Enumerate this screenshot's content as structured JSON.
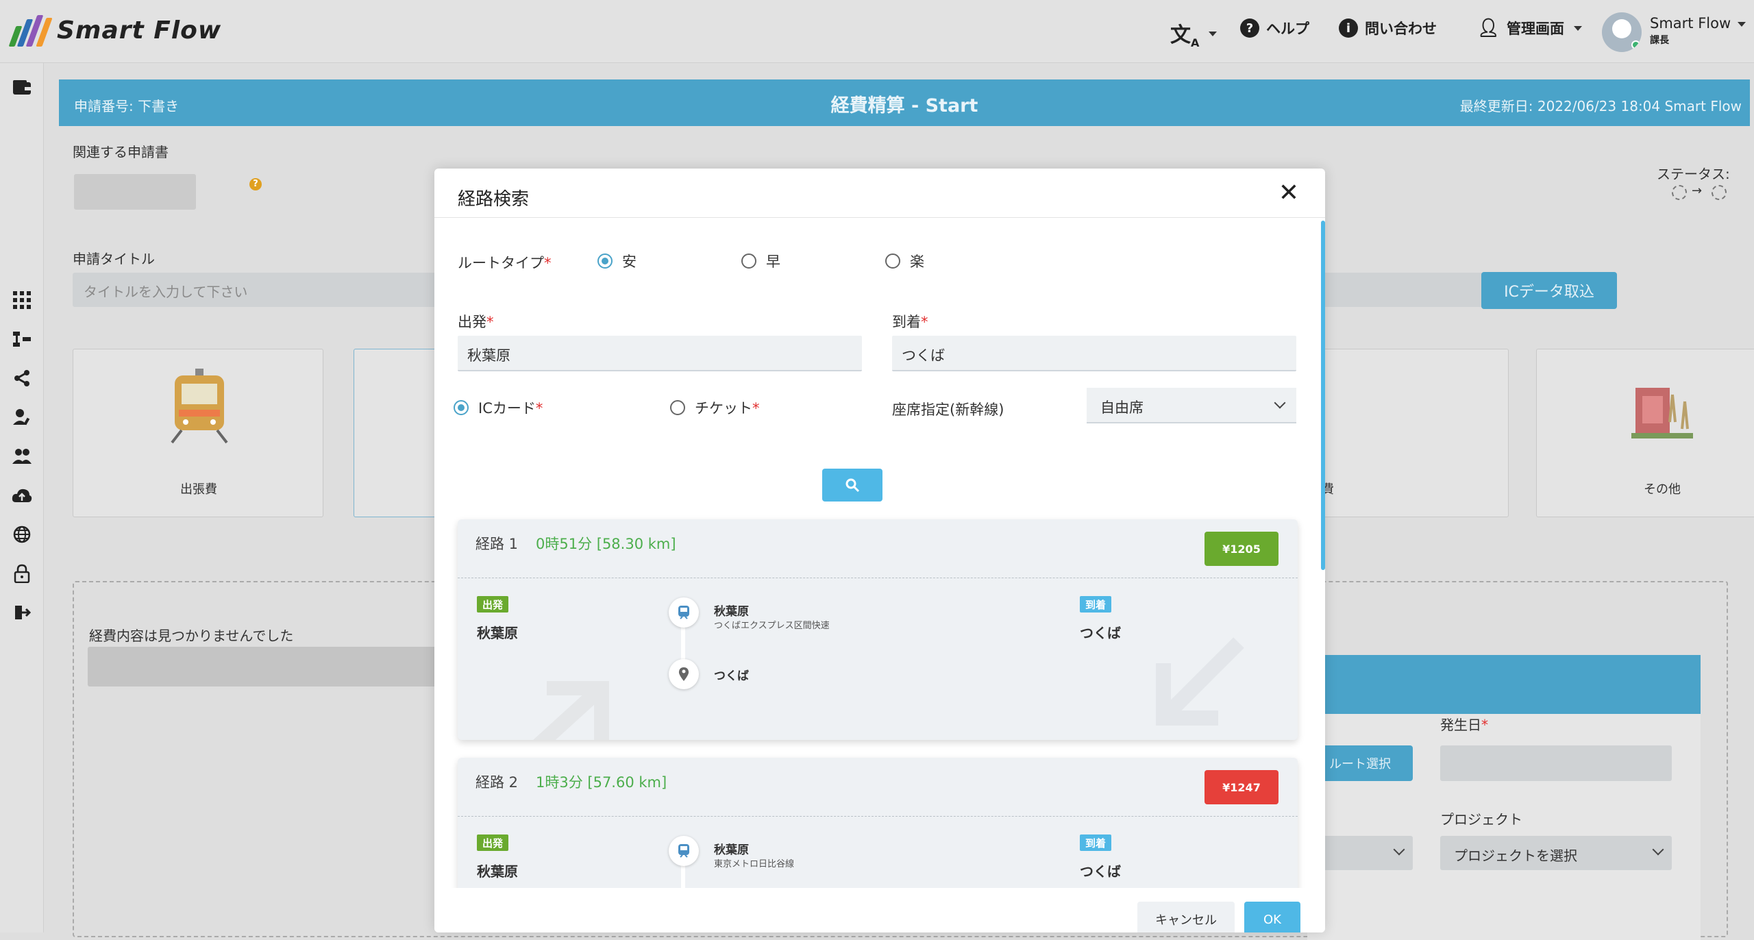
{
  "app": {
    "name": "Smart Flow"
  },
  "topnav": {
    "translate_icon": "translate-icon",
    "help_label": "ヘルプ",
    "contact_label": "問い合わせ",
    "admin_label": "管理画面",
    "user_name": "Smart Flow",
    "user_role": "課長"
  },
  "page": {
    "request_no": "申請番号: 下書き",
    "title": "経費精算 - Start",
    "last_updated": "最終更新日: 2022/06/23 18:04 Smart Flow",
    "related_label": "関連する申請書",
    "status_label": "ステータス:",
    "request_title_label": "申請タイトル",
    "request_title_placeholder": "タイトルを入力して下さい",
    "ic_import_label": "ICデータ取込",
    "cards": [
      "出張費",
      "費",
      "その他"
    ],
    "empty_msg": "経費内容は見つかりませんでした",
    "date_label": "発生日",
    "project_label": "プロジェクト",
    "project_placeholder": "プロジェクトを選択",
    "route_select_label": "ルート選択"
  },
  "modal": {
    "title": "経路検索",
    "route_type_label": "ルートタイプ",
    "route_types": [
      "安",
      "早",
      "楽"
    ],
    "selected_route_type": "安",
    "from_label": "出発",
    "to_label": "到着",
    "from_value": "秋葉原",
    "to_value": "つくば",
    "ic_card_label": "ICカード",
    "ticket_label": "チケット",
    "seat_label": "座席指定(新幹線)",
    "seat_value": "自由席",
    "cancel_label": "キャンセル",
    "ok_label": "OK",
    "routes": [
      {
        "name": "経路 1",
        "time": "0時51分 [58.30 km]",
        "price": "¥1205",
        "price_color": "#6aaa2e",
        "depart_tag": "出発",
        "arrive_tag": "到着",
        "depart_station": "秋葉原",
        "arrive_station": "つくば",
        "stop1": "秋葉原",
        "stop1_line": "つくばエクスプレス区間快速",
        "stop2": "つくば"
      },
      {
        "name": "経路 2",
        "time": "1時3分 [57.60 km]",
        "price": "¥1247",
        "price_color": "#e6403a",
        "depart_tag": "出発",
        "arrive_tag": "到着",
        "depart_station": "秋葉原",
        "arrive_station": "つくば",
        "stop1": "秋葉原",
        "stop1_line": "東京メトロ日比谷線"
      }
    ]
  },
  "colors": {
    "accent": "#4aa3c9",
    "button_blue": "#4fb8e6",
    "green": "#6aaa2e",
    "red": "#e6403a"
  }
}
